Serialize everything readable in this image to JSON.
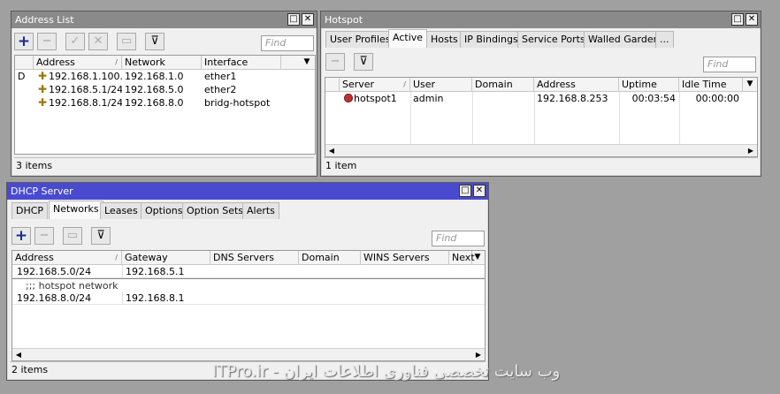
{
  "address_list": {
    "title": "Address List",
    "find_placeholder": "Find",
    "columns": [
      "Address",
      "Network",
      "Interface"
    ],
    "rows": [
      {
        "flag": "D",
        "address": "192.168.1.100...",
        "network": "192.168.1.0",
        "interface": "ether1"
      },
      {
        "flag": "",
        "address": "192.168.5.1/24",
        "network": "192.168.5.0",
        "interface": "ether2"
      },
      {
        "flag": "",
        "address": "192.168.8.1/24",
        "network": "192.168.8.0",
        "interface": "bridg-hotspot"
      }
    ],
    "status": "3 items"
  },
  "hotspot": {
    "title": "Hotspot",
    "tabs": [
      "User Profiles",
      "Active",
      "Hosts",
      "IP Bindings",
      "Service Ports",
      "Walled Garden",
      "..."
    ],
    "selected_tab": "Active",
    "find_placeholder": "Find",
    "columns": [
      "Server",
      "User",
      "Domain",
      "Address",
      "Uptime",
      "Idle Time"
    ],
    "rows": [
      {
        "server": "hotspot1",
        "user": "admin",
        "domain": "",
        "address": "192.168.8.253",
        "uptime": "00:03:54",
        "idle": "00:00:00"
      }
    ],
    "status": "1 item"
  },
  "dhcp": {
    "title": "DHCP Server",
    "tabs": [
      "DHCP",
      "Networks",
      "Leases",
      "Options",
      "Option Sets",
      "Alerts"
    ],
    "selected_tab": "Networks",
    "find_placeholder": "Find",
    "columns": [
      "Address",
      "Gateway",
      "DNS Servers",
      "Domain",
      "WINS Servers",
      "Next"
    ],
    "rows": [
      {
        "address": "192.168.5.0/24",
        "gateway": "192.168.5.1"
      },
      {
        "comment": ";;; hotspot network"
      },
      {
        "address": "192.168.8.0/24",
        "gateway": "192.168.8.1"
      }
    ],
    "status": "2 items"
  },
  "watermark": "وب سایت تخصصی فناوری اطلاعات ایران - ITPro.ir",
  "colors": {
    "active_title": "#4a4ad0",
    "inactive_title": "#8a8a8a",
    "desktop": "#a0a0a0"
  }
}
